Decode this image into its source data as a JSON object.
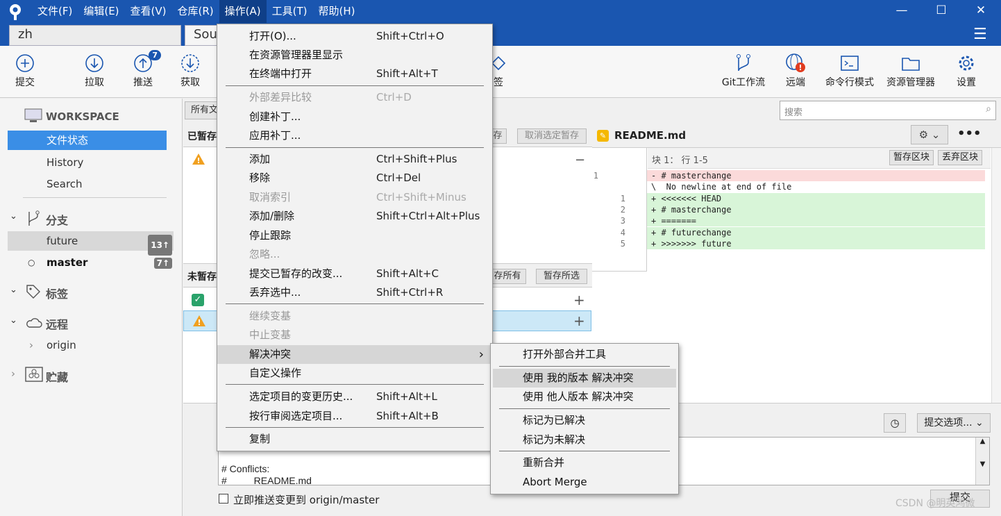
{
  "menubar": {
    "file": "文件(F)",
    "edit": "编辑(E)",
    "view": "查看(V)",
    "repo": "仓库(R)",
    "action": "操作(A)",
    "tools": "工具(T)",
    "help": "帮助(H)"
  },
  "tabs": {
    "tab1": "zh",
    "tab2": "Sou"
  },
  "toolbar": {
    "commit": "提交",
    "pull": "拉取",
    "push": "推送",
    "push_badge": "7",
    "fetch": "获取",
    "tag_partial": "签",
    "gitflow": "Git工作流",
    "remote": "远端",
    "terminal": "命令行模式",
    "explorer": "资源管理器",
    "settings": "设置"
  },
  "sidebar": {
    "workspace": "WORKSPACE",
    "file_status": "文件状态",
    "history": "History",
    "search": "Search",
    "branches": "分支",
    "branch_future": "future",
    "branch_future_badge": "13↑",
    "branch_master": "master",
    "branch_master_badge": "7↑",
    "tags": "标签",
    "remotes": "远程",
    "remote_origin": "origin",
    "stash": "贮藏"
  },
  "center": {
    "filter_partial": "所有文",
    "staged_partial": "已暂存",
    "unstage_btn_partial": "存",
    "unstage_selected": "取消选定暂存",
    "unstaged_partial": "未暂存",
    "stage_all_partial": "存所有",
    "stage_selected": "暂存所选",
    "commit_text_1": "# Conflicts:",
    "commit_text_2": "#          README.md",
    "push_checkbox": "立即推送变更到 origin/master",
    "commit_options": "提交选项...",
    "commit_button": "提交"
  },
  "right": {
    "search_placeholder": "搜索",
    "filename": "README.md",
    "hunk": "块 1： 行 1-5",
    "stage_hunk": "暂存区块",
    "discard_hunk": "丢弃区块"
  },
  "diff": [
    {
      "old": "1",
      "new": "",
      "text": "- # masterchange",
      "kind": "del"
    },
    {
      "old": "",
      "new": "",
      "text": "\\  No newline at end of file",
      "kind": "ctx"
    },
    {
      "old": "",
      "new": "1",
      "text": "+ <<<<<<< HEAD",
      "kind": "add"
    },
    {
      "old": "",
      "new": "2",
      "text": "+ # masterchange",
      "kind": "add"
    },
    {
      "old": "",
      "new": "3",
      "text": "+ =======",
      "kind": "add"
    },
    {
      "old": "",
      "new": "4",
      "text": "+ # futurechange",
      "kind": "add"
    },
    {
      "old": "",
      "new": "5",
      "text": "+ >>>>>>> future",
      "kind": "add"
    }
  ],
  "action_menu": [
    {
      "label": "打开(O)...",
      "shortcut": "Shift+Ctrl+O",
      "disabled": false
    },
    {
      "label": "在资源管理器里显示",
      "shortcut": "",
      "disabled": false
    },
    {
      "label": "在终端中打开",
      "shortcut": "Shift+Alt+T",
      "disabled": false
    },
    {
      "label": "外部差异比较",
      "shortcut": "Ctrl+D",
      "disabled": true
    },
    {
      "label": "创建补丁...",
      "shortcut": "",
      "disabled": false
    },
    {
      "label": "应用补丁...",
      "shortcut": "",
      "disabled": false
    },
    {
      "label": "添加",
      "shortcut": "Ctrl+Shift+Plus",
      "disabled": false
    },
    {
      "label": "移除",
      "shortcut": "Ctrl+Del",
      "disabled": false
    },
    {
      "label": "取消索引",
      "shortcut": "Ctrl+Shift+Minus",
      "disabled": true
    },
    {
      "label": "添加/删除",
      "shortcut": "Shift+Ctrl+Alt+Plus",
      "disabled": false
    },
    {
      "label": "停止跟踪",
      "shortcut": "",
      "disabled": false
    },
    {
      "label": "忽略...",
      "shortcut": "",
      "disabled": true
    },
    {
      "label": "提交已暂存的改变...",
      "shortcut": "Shift+Alt+C",
      "disabled": false
    },
    {
      "label": "丢弃选中...",
      "shortcut": "Shift+Ctrl+R",
      "disabled": false
    },
    {
      "label": "继续变基",
      "shortcut": "",
      "disabled": true
    },
    {
      "label": "中止变基",
      "shortcut": "",
      "disabled": true
    },
    {
      "label": "解决冲突",
      "shortcut": "",
      "disabled": false
    },
    {
      "label": "自定义操作",
      "shortcut": "",
      "disabled": false
    },
    {
      "label": "选定项目的变更历史...",
      "shortcut": "Shift+Alt+L",
      "disabled": false
    },
    {
      "label": "按行审阅选定项目...",
      "shortcut": "Shift+Alt+B",
      "disabled": false
    },
    {
      "label": "复制",
      "shortcut": "",
      "disabled": false
    }
  ],
  "conflict_submenu": [
    {
      "label": "打开外部合并工具"
    },
    {
      "label": "使用 我的版本 解决冲突"
    },
    {
      "label": "使用 他人版本 解决冲突"
    },
    {
      "label": "标记为已解决"
    },
    {
      "label": "标记为未解决"
    },
    {
      "label": "重新合并"
    },
    {
      "label": "Abort Merge"
    }
  ],
  "watermark": "CSDN @明英鸿微",
  "colors": {
    "titlebar": "#1a56b0",
    "selection": "#3a8ee6",
    "diff_add": "#d8f5d8",
    "diff_del": "#fbdada"
  }
}
